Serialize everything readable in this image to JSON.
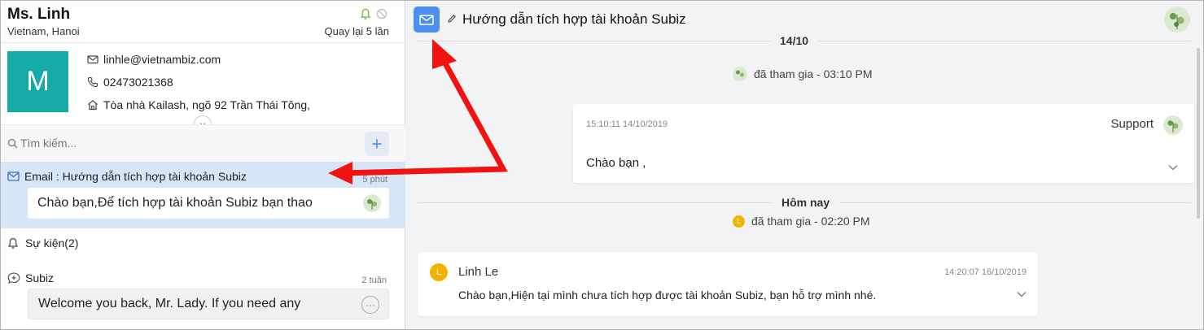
{
  "customer": {
    "name": "Ms. Linh",
    "location": "Vietnam, Hanoi",
    "revisit": "Quay lại 5 lần",
    "avatar_letter": "M",
    "email": "linhle@vietnambiz.com",
    "phone": "02473021368",
    "address": "Tòa nhà Kailash, ngõ 92 Trần Thái Tông,"
  },
  "search": {
    "placeholder": "Tìm kiếm..."
  },
  "conversations": [
    {
      "title": "Email : Hướng dẫn tích hợp tài khoản Subiz",
      "time": "5 phút",
      "preview": "Chào bạn,Để tích hợp tài khoản Subiz bạn thao"
    },
    {
      "title": "Sự kiện(2)"
    },
    {
      "title": "Subiz",
      "time": "2 tuần",
      "preview": "Welcome you back, Mr. Lady. If you need any"
    }
  ],
  "thread": {
    "subject": "Hướng dẫn tích hợp tài khoản Subiz",
    "date1": "14/10",
    "joined1": "đã tham gia - 03:10 PM",
    "msg1": {
      "time": "15:10:11 14/10/2019",
      "author": "Support",
      "text": "Chào bạn ,"
    },
    "date2": "Hôm nay",
    "joined2": "đã tham gia - 02:20 PM",
    "msg2": {
      "author_initial": "L",
      "author": "Linh Le",
      "time": "14:20:07 16/10/2019",
      "text": "Chào bạn,Hiện tại mình chưa tích hợp được tài khoản Subiz, bạn hỗ trợ mình nhé."
    }
  },
  "colors": {
    "accent": "#4b8ef0",
    "avatar_teal": "#15aaa5",
    "selected_row": "#d6e6f7",
    "annotation_arrow": "#f21212",
    "online": "#7ac142"
  }
}
